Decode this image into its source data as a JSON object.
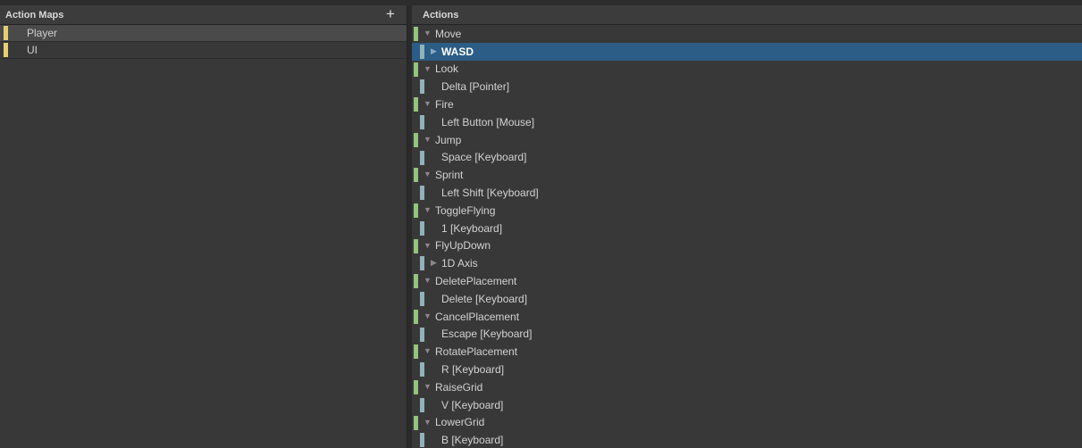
{
  "action_maps": {
    "title": "Action Maps",
    "add_label": "+",
    "items": [
      {
        "label": "Player",
        "selected": true
      },
      {
        "label": "UI",
        "selected": false
      }
    ]
  },
  "actions": {
    "title": "Actions",
    "items": [
      {
        "kind": "action",
        "label": "Move",
        "expanded": true
      },
      {
        "kind": "binding",
        "label": "WASD",
        "composite": true,
        "selected": true
      },
      {
        "kind": "action",
        "label": "Look",
        "expanded": true
      },
      {
        "kind": "binding",
        "label": "Delta [Pointer]"
      },
      {
        "kind": "action",
        "label": "Fire",
        "expanded": true
      },
      {
        "kind": "binding",
        "label": "Left Button [Mouse]"
      },
      {
        "kind": "action",
        "label": "Jump",
        "expanded": true
      },
      {
        "kind": "binding",
        "label": "Space [Keyboard]"
      },
      {
        "kind": "action",
        "label": "Sprint",
        "expanded": true
      },
      {
        "kind": "binding",
        "label": "Left Shift [Keyboard]"
      },
      {
        "kind": "action",
        "label": "ToggleFlying",
        "expanded": true
      },
      {
        "kind": "binding",
        "label": "1 [Keyboard]"
      },
      {
        "kind": "action",
        "label": "FlyUpDown",
        "expanded": true
      },
      {
        "kind": "binding",
        "label": "1D Axis",
        "composite": true
      },
      {
        "kind": "action",
        "label": "DeletePlacement",
        "expanded": true
      },
      {
        "kind": "binding",
        "label": "Delete [Keyboard]"
      },
      {
        "kind": "action",
        "label": "CancelPlacement",
        "expanded": true
      },
      {
        "kind": "binding",
        "label": "Escape [Keyboard]"
      },
      {
        "kind": "action",
        "label": "RotatePlacement",
        "expanded": true
      },
      {
        "kind": "binding",
        "label": "R [Keyboard]"
      },
      {
        "kind": "action",
        "label": "RaiseGrid",
        "expanded": true
      },
      {
        "kind": "binding",
        "label": "V [Keyboard]"
      },
      {
        "kind": "action",
        "label": "LowerGrid",
        "expanded": true
      },
      {
        "kind": "binding",
        "label": "B [Keyboard]"
      }
    ]
  },
  "colors": {
    "action_marker": "#93c47d",
    "binding_marker": "#8fb3b8",
    "map_marker": "#e8cd72",
    "selection": "#2c5d87"
  }
}
